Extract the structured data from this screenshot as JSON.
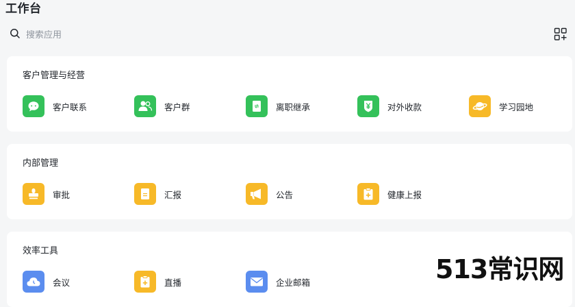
{
  "page": {
    "title": "工作台"
  },
  "search": {
    "placeholder": "搜索应用"
  },
  "colors": {
    "green": "#34c15a",
    "yellow": "#f7b928",
    "blue": "#5b8def",
    "background": "#f5f6f7"
  },
  "sections": [
    {
      "title": "客户管理与经营",
      "apps": [
        {
          "label": "客户联系",
          "icon": "chat-bubble-icon"
        },
        {
          "label": "客户群",
          "icon": "group-users-icon"
        },
        {
          "label": "离职继承",
          "icon": "handover-document-icon"
        },
        {
          "label": "对外收款",
          "icon": "yuan-shield-icon"
        },
        {
          "label": "学习园地",
          "icon": "planet-icon"
        }
      ]
    },
    {
      "title": "内部管理",
      "apps": [
        {
          "label": "审批",
          "icon": "stamp-icon"
        },
        {
          "label": "汇报",
          "icon": "report-document-icon"
        },
        {
          "label": "公告",
          "icon": "megaphone-icon"
        },
        {
          "label": "健康上报",
          "icon": "health-clipboard-icon"
        }
      ]
    },
    {
      "title": "效率工具",
      "apps": [
        {
          "label": "会议",
          "icon": "cloud-meeting-icon"
        },
        {
          "label": "直播",
          "icon": "live-clipboard-icon"
        },
        {
          "label": "企业邮箱",
          "icon": "mail-icon"
        }
      ]
    }
  ],
  "watermark": {
    "text": "513常识网"
  }
}
